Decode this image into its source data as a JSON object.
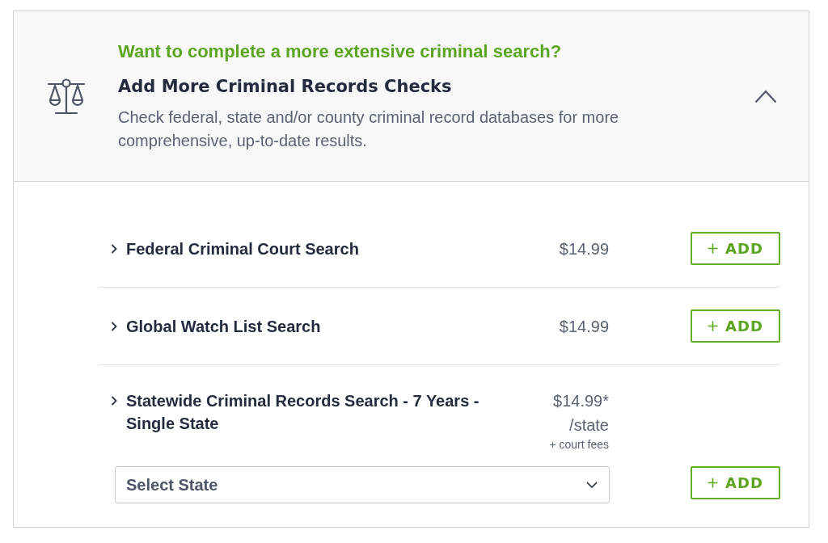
{
  "header": {
    "eyebrow": "Want to complete a more extensive criminal search?",
    "title": "Add More Criminal Records Checks",
    "description": "Check federal, state and/or county criminal record databases for more comprehensive, up-to-date results.",
    "expanded": true
  },
  "items": [
    {
      "kind": "standard",
      "name": "Federal Criminal Court Search",
      "price": "$14.99",
      "expanded": false,
      "button": "ADD"
    },
    {
      "kind": "standard",
      "name": "Global Watch List Search",
      "price": "$14.99",
      "expanded": false,
      "button": "ADD"
    },
    {
      "kind": "statewide",
      "name": "Statewide Criminal Records Search - 7 Years - Single State",
      "price": "$14.99*",
      "unit": "/state",
      "note": "+ court fees",
      "select": {
        "placeholder": "Select State"
      },
      "expanded": false,
      "button": "ADD"
    }
  ]
}
